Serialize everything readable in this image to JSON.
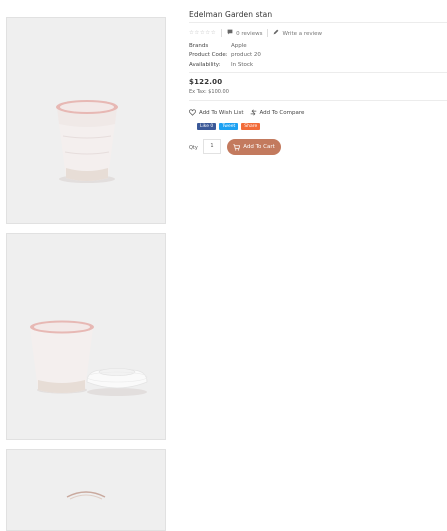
{
  "product": {
    "title": "Edelman Garden stan",
    "stars": "☆☆☆☆☆",
    "reviews_link": "0 reviews",
    "write_review_link": "Write a review",
    "specs": [
      {
        "key": "Brands",
        "value": "Apple"
      },
      {
        "key": "Product Code:",
        "value": "product 20"
      },
      {
        "key": "Availability:",
        "value": "In Stock"
      }
    ],
    "price": "$122.00",
    "ex_tax": "Ex Tax: $100.00",
    "wishlist_label": "Add To Wish List",
    "compare_label": "Add To Compare",
    "social": {
      "like": "Like 0",
      "tweet": "Tweet",
      "share": "Share"
    },
    "qty_label": "Qty",
    "qty_value": "1",
    "add_to_cart": "Add To Cart"
  },
  "colors": {
    "accent": "#c37a5e",
    "facebook": "#3b5998",
    "twitter": "#1da1f2",
    "share": "#f26b38"
  },
  "icons": [
    "speech-bubble-icon",
    "pencil-icon",
    "heart-icon",
    "compare-arrows-icon",
    "cart-icon"
  ]
}
